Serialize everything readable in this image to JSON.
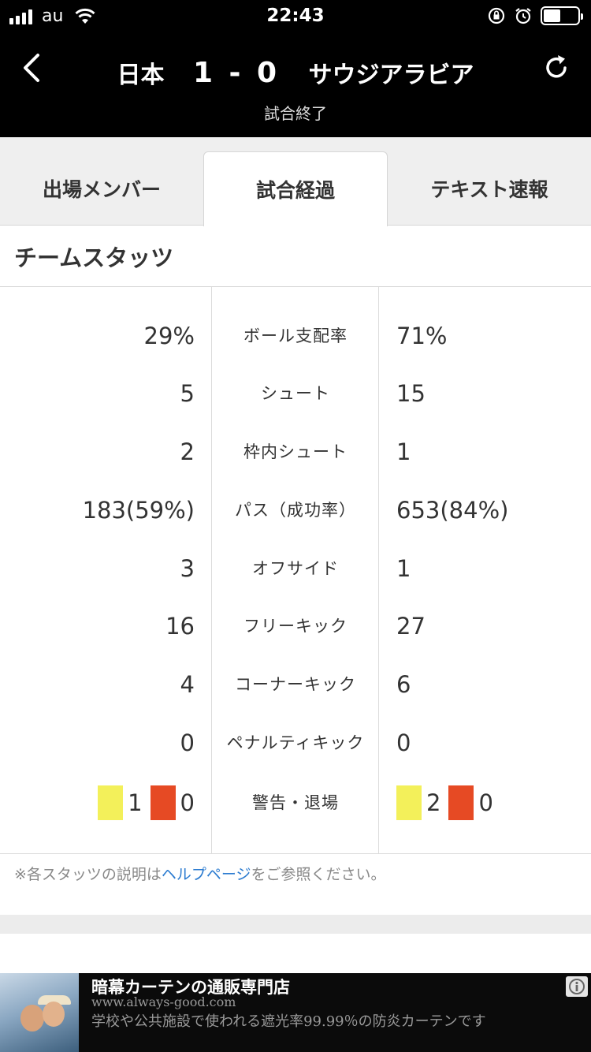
{
  "status_bar": {
    "carrier": "au",
    "time": "22:43",
    "battery_level": 0.5
  },
  "header": {
    "home_team": "日本",
    "score": "1 - 0",
    "away_team": "サウジアラビア",
    "match_status": "試合終了"
  },
  "tabs": [
    {
      "label": "出場メンバー",
      "active": false
    },
    {
      "label": "試合経過",
      "active": true
    },
    {
      "label": "テキスト速報",
      "active": false
    }
  ],
  "section_title": "チームスタッツ",
  "stats": [
    {
      "left": "29%",
      "label": "ボール支配率",
      "right": "71%"
    },
    {
      "left": "5",
      "label": "シュート",
      "right": "15"
    },
    {
      "left": "2",
      "label": "枠内シュート",
      "right": "1"
    },
    {
      "left": "183(59%)",
      "label": "パス（成功率）",
      "right": "653(84%)"
    },
    {
      "left": "3",
      "label": "オフサイド",
      "right": "1"
    },
    {
      "left": "16",
      "label": "フリーキック",
      "right": "27"
    },
    {
      "left": "4",
      "label": "コーナーキック",
      "right": "6"
    },
    {
      "left": "0",
      "label": "ペナルティキック",
      "right": "0"
    }
  ],
  "cards_row": {
    "label": "警告・退場",
    "left_yellow": "1",
    "left_red": "0",
    "right_yellow": "2",
    "right_red": "0",
    "yellow_color": "#f3f05a",
    "red_color": "#e64a24"
  },
  "note": {
    "prefix": "※各スタッツの説明は",
    "link": "ヘルプページ",
    "suffix": "をご参照ください。",
    "link_color": "#2b7bd0"
  },
  "ad": {
    "title": "暗幕カーテンの通販専門店",
    "url": "www.always-good.com",
    "description": "学校や公共施設で使われる遮光率99.99％の防炎カーテンです"
  },
  "icons": {
    "back": "chevron-left-icon",
    "refresh": "refresh-icon",
    "ad_info": "info-icon"
  }
}
